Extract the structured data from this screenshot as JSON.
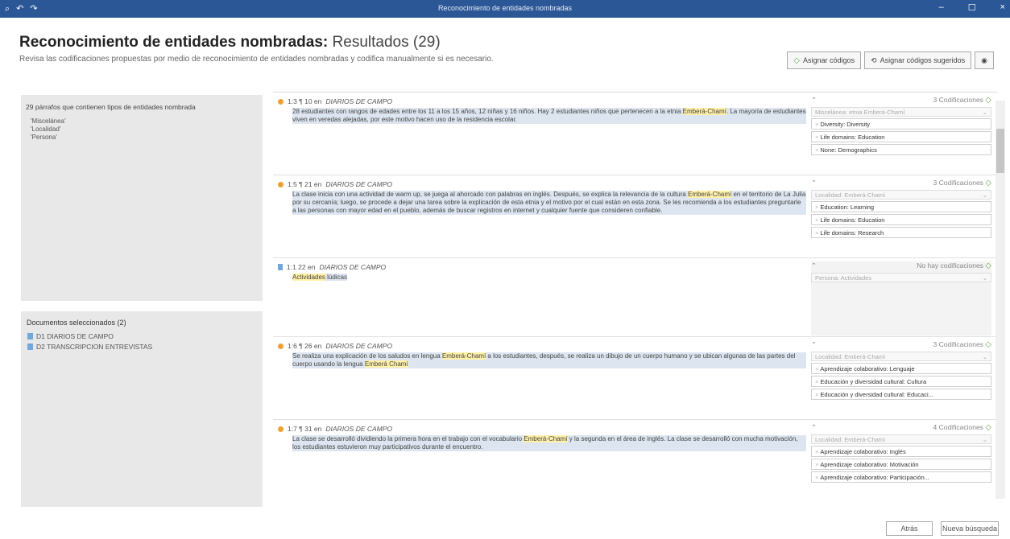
{
  "window": {
    "title": "Reconocimiento de entidades nombradas",
    "icons": [
      "search-icon",
      "undo-icon",
      "redo-icon"
    ],
    "controls": {
      "minimize": "–",
      "maximize": "☐",
      "close": "×"
    }
  },
  "header": {
    "title_bold": "Reconocimiento de entidades nombradas:",
    "title_light": "Resultados (29)",
    "subtitle": "Revisa las codificaciones propuestas por medio de reconocimiento de entidades nombradas y codifica manualmente si es necesario.",
    "assign_codes": "Asignar códigos",
    "assign_suggested": "Asignar códigos sugeridos",
    "view_icon": "eye-icon"
  },
  "left": {
    "summary": "29 párrafos que contienen tipos de entidades nombrada",
    "types": [
      "'Miscelánea'",
      "'Localidad'",
      "'Persona'"
    ],
    "docs_title": "Documentos seleccionados (2)",
    "docs": [
      "D1 DIARIOS DE CAMPO",
      "D2 TRANSCRIPCION ENTREVISTAS"
    ]
  },
  "cards": [
    {
      "ref": "1:3 ¶ 10 en",
      "source": "DIARIOS DE CAMPO",
      "count": "3 Codificaciones",
      "dropdown": "Miscelánea: etnia Emberá-Chamí",
      "codes": [
        "Diversity: Diversity",
        "Life domains: Education",
        "None: Demographics"
      ],
      "text_a": "28 estudiantes con rangos de edades entre los 11 a los 15 años, 12 niñas y 16 niños. Hay 2 estudiantes niños que pertenecen a la etnia",
      "ent1": "Emberá-Chamí",
      "text_b": ". La mayoría de estudiantes viven en veredas alejadas, por este motivo hacen uso de la residencia escolar."
    },
    {
      "ref": "1:5 ¶ 21 en",
      "source": "DIARIOS DE CAMPO",
      "count": "3 Codificaciones",
      "dropdown": "Localidad: Emberá-Chamí",
      "codes": [
        "Education: Learning",
        "Life domains: Education",
        "Life domains: Research"
      ],
      "text_a": "La clase inicia con una actividad de warm up, se juega al ahorcado con palabras en inglés. Después, se explica la relevancia de la cultura",
      "ent1": "Emberá-Chamí",
      "text_b": " en el territorio de La Julia por su cercanía; luego, se procede a dejar una tarea sobre la explicación de esta etnia y el motivo por el cual están en esta zona. Se les recomienda a los estudiantes preguntarle a las personas con mayor edad en el pueblo, además de buscar registros en internet y cualquier fuente que consideren confiable."
    },
    {
      "ref": "1:1 22 en",
      "source": "DIARIOS DE CAMPO",
      "count": "No hay codificaciones",
      "dropdown": "Persona: Actividades",
      "codes": [],
      "text_a": "Actividades",
      "ent1": "",
      "text_b": " lúdicas"
    },
    {
      "ref": "1:6 ¶ 26 en",
      "source": "DIARIOS DE CAMPO",
      "count": "3 Codificaciones",
      "dropdown": "Localidad: Emberá-Chamí",
      "codes": [
        "Aprendizaje colaborativo: Lenguaje",
        "Educación y diversidad cultural: Cultura",
        "Educación y diversidad cultural: Educaci..."
      ],
      "text_a": "Se realiza una explicación de los saludos en lengua",
      "ent1": "Emberá-Chamí",
      "text_b": " a los estudiantes, después, se realiza un dibujo de un cuerpo humano y se ubican algunas de las partes del cuerpo usando la lengua",
      "ent2": "Emberá Chamí"
    },
    {
      "ref": "1:7 ¶ 31 en",
      "source": "DIARIOS DE CAMPO",
      "count": "4 Codificaciones",
      "dropdown": "Localidad: Emberá-Chamí",
      "codes": [
        "Aprendizaje colaborativo: Inglés",
        "Aprendizaje colaborativo: Motivación",
        "Aprendizaje colaborativo: Participación..."
      ],
      "text_a": "La clase se desarrolló dividiendo la primera hora en el trabajo con el vocabulario",
      "ent1": "Emberá-Chamí",
      "text_b": " y la segunda en el área de inglés. La clase se desarrolló con mucha motivación, los estudiantes estuvieron muy participativos durante el encuentro."
    }
  ],
  "footer": {
    "back": "Atrás",
    "new_search": "Nueva búsqueda"
  }
}
